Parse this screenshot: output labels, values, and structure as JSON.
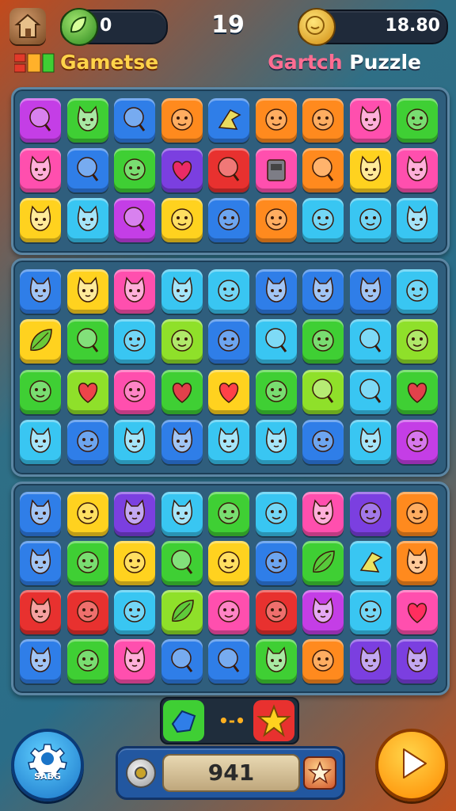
{
  "header": {
    "leaf_count": "0",
    "level": "19",
    "coin_balance": "18.80",
    "title_left": "Gametse",
    "title_right_prefix": "Gartch",
    "title_right_suffix": " Puzzle"
  },
  "colors": {
    "orange": "#ff8a1e",
    "yellow": "#ffd21f",
    "green": "#3fcf34",
    "lime": "#8fe02a",
    "blue": "#2f7ee8",
    "cyan": "#39c6f2",
    "pink": "#ff4fae",
    "magenta": "#c43ee6",
    "purple": "#7b3fe0",
    "red": "#e8312f",
    "teal": "#2fc6a8"
  },
  "boards": [
    {
      "rows": [
        [
          [
            "magenta",
            "balloon"
          ],
          [
            "green",
            "cat"
          ],
          [
            "blue",
            "balloon"
          ],
          [
            "orange",
            "face"
          ],
          [
            "blue",
            "arrow"
          ],
          [
            "orange",
            "face"
          ],
          [
            "orange",
            "face"
          ],
          [
            "pink",
            "cat"
          ],
          [
            "green",
            "face"
          ]
        ],
        [
          [
            "pink",
            "cat"
          ],
          [
            "blue",
            "balloon"
          ],
          [
            "green",
            "face"
          ],
          [
            "purple",
            "heart"
          ],
          [
            "red",
            "balloon"
          ],
          [
            "pink",
            "box"
          ],
          [
            "orange",
            "balloon"
          ],
          [
            "yellow",
            "cat"
          ],
          [
            "pink",
            "cat"
          ]
        ],
        [
          [
            "yellow",
            "cat"
          ],
          [
            "cyan",
            "cat"
          ],
          [
            "magenta",
            "balloon"
          ],
          [
            "yellow",
            "face"
          ],
          [
            "blue",
            "face"
          ],
          [
            "orange",
            "face"
          ],
          [
            "cyan",
            "face"
          ],
          [
            "cyan",
            "face"
          ],
          [
            "cyan",
            "cat"
          ]
        ]
      ]
    },
    {
      "rows": [
        [
          [
            "blue",
            "cat"
          ],
          [
            "yellow",
            "cat"
          ],
          [
            "pink",
            "cat"
          ],
          [
            "cyan",
            "cat"
          ],
          [
            "cyan",
            "face"
          ],
          [
            "blue",
            "cat"
          ],
          [
            "blue",
            "cat"
          ],
          [
            "blue",
            "cat"
          ],
          [
            "cyan",
            "face"
          ]
        ],
        [
          [
            "yellow",
            "leaf"
          ],
          [
            "green",
            "balloon"
          ],
          [
            "cyan",
            "face"
          ],
          [
            "lime",
            "face"
          ],
          [
            "blue",
            "face"
          ],
          [
            "cyan",
            "balloon"
          ],
          [
            "green",
            "face"
          ],
          [
            "cyan",
            "balloon"
          ],
          [
            "lime",
            "face"
          ]
        ],
        [
          [
            "green",
            "face"
          ],
          [
            "lime",
            "heart"
          ],
          [
            "pink",
            "face"
          ],
          [
            "green",
            "heart"
          ],
          [
            "yellow",
            "heart"
          ],
          [
            "green",
            "face"
          ],
          [
            "lime",
            "balloon"
          ],
          [
            "cyan",
            "balloon"
          ],
          [
            "green",
            "heart"
          ]
        ],
        [
          [
            "cyan",
            "cat"
          ],
          [
            "blue",
            "face"
          ],
          [
            "cyan",
            "cat"
          ],
          [
            "blue",
            "cat"
          ],
          [
            "cyan",
            "cat"
          ],
          [
            "cyan",
            "cat"
          ],
          [
            "blue",
            "face"
          ],
          [
            "cyan",
            "cat"
          ],
          [
            "magenta",
            "face"
          ]
        ]
      ]
    },
    {
      "rows": [
        [
          [
            "blue",
            "cat"
          ],
          [
            "yellow",
            "face"
          ],
          [
            "purple",
            "cat"
          ],
          [
            "cyan",
            "cat"
          ],
          [
            "green",
            "face"
          ],
          [
            "cyan",
            "face"
          ],
          [
            "pink",
            "cat"
          ],
          [
            "purple",
            "face"
          ],
          [
            "orange",
            "face"
          ]
        ],
        [
          [
            "blue",
            "cat"
          ],
          [
            "green",
            "face"
          ],
          [
            "yellow",
            "face"
          ],
          [
            "green",
            "balloon"
          ],
          [
            "yellow",
            "face"
          ],
          [
            "blue",
            "face"
          ],
          [
            "green",
            "leaf"
          ],
          [
            "cyan",
            "arrow"
          ],
          [
            "orange",
            "cat"
          ]
        ],
        [
          [
            "red",
            "cat"
          ],
          [
            "red",
            "face"
          ],
          [
            "cyan",
            "face"
          ],
          [
            "lime",
            "leaf"
          ],
          [
            "pink",
            "face"
          ],
          [
            "red",
            "face"
          ],
          [
            "magenta",
            "cat"
          ],
          [
            "cyan",
            "face"
          ],
          [
            "pink",
            "heart"
          ]
        ],
        [
          [
            "blue",
            "cat"
          ],
          [
            "green",
            "face"
          ],
          [
            "pink",
            "cat"
          ],
          [
            "blue",
            "balloon"
          ],
          [
            "blue",
            "balloon"
          ],
          [
            "green",
            "cat"
          ],
          [
            "orange",
            "face"
          ],
          [
            "purple",
            "cat"
          ],
          [
            "purple",
            "cat"
          ]
        ]
      ]
    }
  ],
  "bottom": {
    "settings_label": "SABG",
    "score": "941",
    "left_swap_color": "green",
    "right_swap_color": "red",
    "swap_dots": "•-•"
  },
  "icons": [
    "home-icon",
    "leaf-coin-icon",
    "gold-coin-icon",
    "gear-icon",
    "play-icon",
    "star-icon"
  ]
}
